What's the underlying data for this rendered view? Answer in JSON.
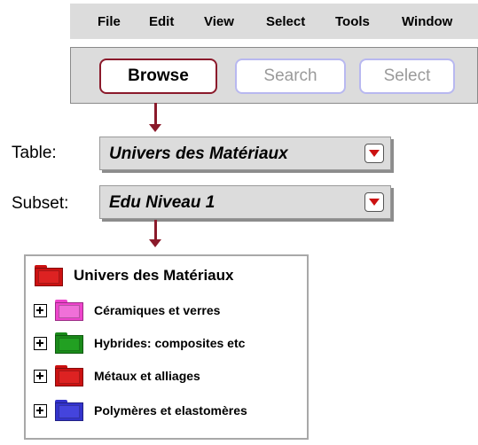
{
  "menubar": {
    "items": [
      "File",
      "Edit",
      "View",
      "Select",
      "Tools",
      "Window"
    ]
  },
  "toolbar": {
    "browse_label": "Browse",
    "search_label": "Search",
    "select_label": "Select",
    "active_tab": "Browse"
  },
  "table": {
    "label": "Table:",
    "value": "Univers des Matériaux"
  },
  "subset": {
    "label": "Subset:",
    "value": "Edu Niveau 1"
  },
  "tree": {
    "root": {
      "label": "Univers des Matériaux",
      "icon": "folder-icon",
      "color": "#cc1111"
    },
    "items": [
      {
        "label": "Céramiques et verres",
        "icon": "folder-icon",
        "color": "#ee44cc"
      },
      {
        "label": "Hybrides: composites etc",
        "icon": "folder-icon",
        "color": "#1a8a1a"
      },
      {
        "label": "Métaux et alliages",
        "icon": "folder-icon",
        "color": "#cc1111"
      },
      {
        "label": "Polymères et elastomères",
        "icon": "folder-icon",
        "color": "#3333cc"
      }
    ]
  },
  "colors": {
    "accent": "#8b1a2b",
    "inactive_border": "#b8b8f0",
    "panel_gray": "#dcdcdc"
  }
}
